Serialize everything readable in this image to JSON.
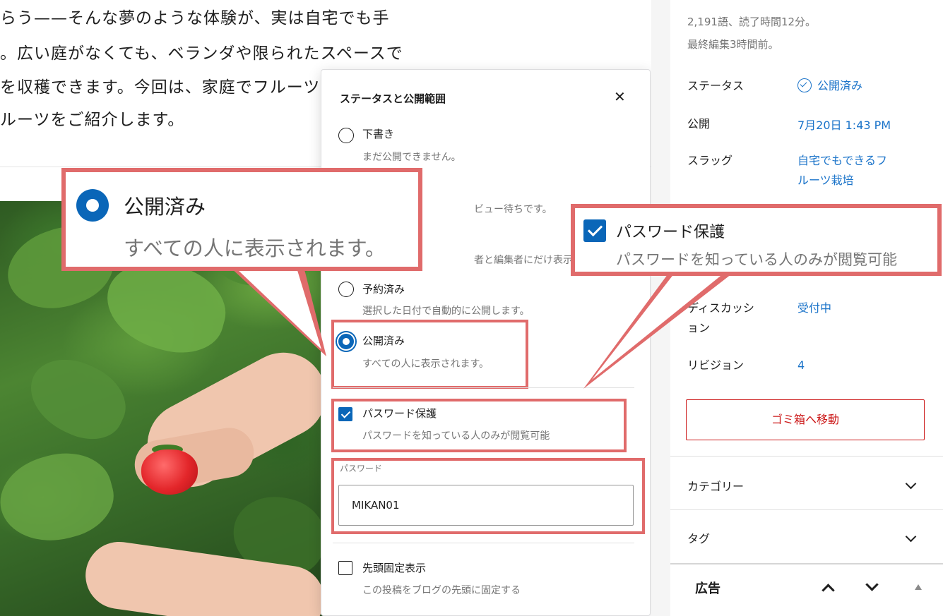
{
  "editor": {
    "paragraph_lines": [
      "らう——そんな夢のような体験が、実は自宅でも手",
      "。広い庭がなくても、ベランダや限られたスペースで",
      "を収穫できます。今回は、家庭でフルーツ",
      "ルーツをご紹介します。"
    ],
    "image_alt": "strawberry-harvest-photo"
  },
  "popover": {
    "title": "ステータスと公開範囲",
    "close_icon": "close-icon",
    "options": [
      {
        "label": "下書き",
        "description": "まだ公開できません。",
        "checked": false
      },
      {
        "label": "予約済み",
        "description": "選択した日付で自動的に公開します。",
        "checked": false
      },
      {
        "label": "公開済み",
        "description": "すべての人に表示されます。",
        "checked": true
      }
    ],
    "hidden_fragments": {
      "pending_desc": "ビュー待ちです。",
      "private_desc": "者と編集者にだけ表示され"
    },
    "password_protect": {
      "label": "パスワード保護",
      "description": "パスワードを知っている人のみが閲覧可能",
      "checked": true
    },
    "password": {
      "caption": "パスワード",
      "value": "MIKAN01"
    },
    "sticky": {
      "label": "先頭固定表示",
      "description": "この投稿をブログの先頭に固定する",
      "checked": false
    }
  },
  "sidebar": {
    "word_count": "2,191語、読了時間12分。",
    "last_edited": "最終編集3時間前。",
    "rows": [
      {
        "key": "ステータス",
        "value": "公開済み"
      },
      {
        "key": "公開",
        "value": "7月20日 1:43 PM"
      },
      {
        "key": "スラッグ",
        "value_lines": [
          "自宅でもできるフ",
          "ルーツ栽培"
        ]
      }
    ],
    "discussion": {
      "key_lines": [
        "ディスカッシ",
        "ョン"
      ],
      "value": "受付中"
    },
    "revisions": {
      "key": "リビジョン",
      "value": "4"
    },
    "trash_label": "ゴミ箱へ移動",
    "sections": [
      {
        "label": "カテゴリー"
      },
      {
        "label": "タグ"
      }
    ],
    "ads_label": "広告"
  },
  "callouts": {
    "published": {
      "title": "公開済み",
      "description": "すべての人に表示されます。"
    },
    "password": {
      "title": "パスワード保護",
      "description": "パスワードを知っている人のみが閲覧可能"
    }
  },
  "colors": {
    "accent": "#0a66b8",
    "link": "#1a73c9",
    "highlight": "#e06b6b",
    "danger": "#cc1818"
  }
}
